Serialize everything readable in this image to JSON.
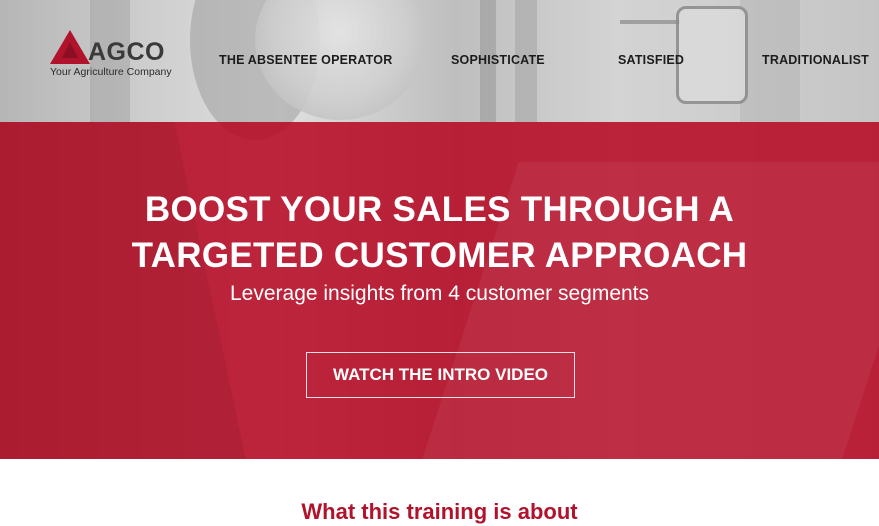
{
  "brand": {
    "logo_text": "AGCO",
    "tagline": "Your Agriculture Company",
    "accent_color": "#b0132b"
  },
  "nav": {
    "items": [
      {
        "label": "THE ABSENTEE OPERATOR"
      },
      {
        "label": "SOPHISTICATE"
      },
      {
        "label": "SATISFIED"
      },
      {
        "label": "TRADITIONALIST"
      }
    ]
  },
  "hero": {
    "title_line1": "BOOST YOUR SALES THROUGH A",
    "title_line2": "TARGETED CUSTOMER APPROACH",
    "subtitle": "Leverage insights from 4 customer segments",
    "cta_label": "WATCH THE INTRO VIDEO",
    "overlay_color": "#ba122b"
  },
  "section": {
    "heading": "What this training is about"
  }
}
